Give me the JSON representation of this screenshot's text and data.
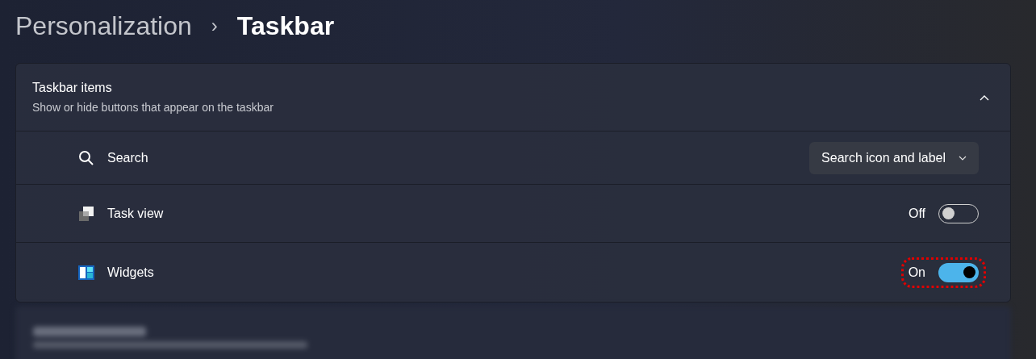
{
  "breadcrumb": {
    "parent": "Personalization",
    "separator": "›",
    "current": "Taskbar"
  },
  "section": {
    "title": "Taskbar items",
    "subtitle": "Show or hide buttons that appear on the taskbar",
    "expanded": true,
    "rows": [
      {
        "kind": "dropdown",
        "label": "Search",
        "value": "Search icon and label",
        "highlighted": false
      },
      {
        "kind": "toggle",
        "label": "Task view",
        "on": false,
        "state_label": "Off",
        "highlighted": false
      },
      {
        "kind": "toggle",
        "label": "Widgets",
        "on": true,
        "state_label": "On",
        "highlighted": true
      }
    ]
  },
  "next_section": {
    "kind": "blurred"
  }
}
